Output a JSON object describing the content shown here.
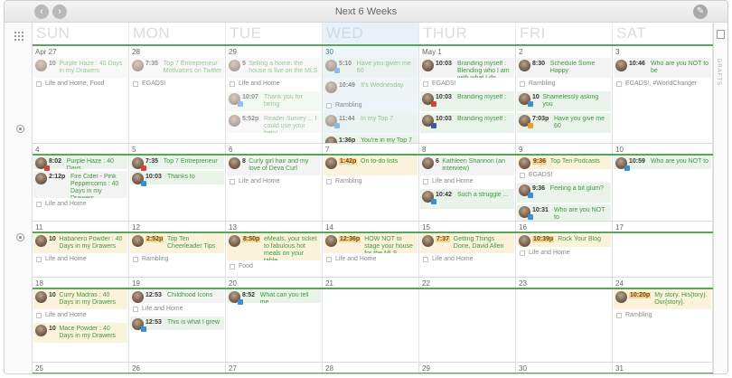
{
  "header": {
    "title": "Next 6 Weeks",
    "prev_icon": "chevron-left-icon",
    "next_icon": "chevron-right-icon",
    "edit_icon": "pencil-icon"
  },
  "sidebar": {
    "drafts_label": "DRAFTS"
  },
  "days": [
    "SUN",
    "MON",
    "TUE",
    "WED",
    "THUR",
    "FRI",
    "SAT"
  ],
  "colors": {
    "accent": "#5aa55a",
    "post_text": "#3d9a3d",
    "time_highlight": "#f5d590",
    "today_bg": "#eef5fa"
  },
  "weeks": [
    {
      "days": [
        {
          "date": "Apr 27",
          "items": [
            {
              "kind": "post",
              "time": "10",
              "text": "Purple Haze : 40 Days in my Drawers",
              "badge": "none",
              "style": "faded"
            },
            {
              "kind": "cat",
              "text": "Life and Home, Food"
            }
          ]
        },
        {
          "date": "28",
          "items": [
            {
              "kind": "post",
              "time": "7:35",
              "text": "Top 7 Entrepreneur Motivators on Twitter",
              "badge": "none",
              "style": "faded"
            },
            {
              "kind": "cat",
              "text": "EGADS!"
            }
          ]
        },
        {
          "date": "29",
          "items": [
            {
              "kind": "post",
              "time": "5",
              "text": "Selling a home: the house is live on the MLS",
              "badge": "none",
              "style": "faded"
            },
            {
              "kind": "cat",
              "text": "Life and Home"
            },
            {
              "kind": "post",
              "time": "10:07",
              "text": "Thank you for being",
              "badge": "tw",
              "style": "faded-hl"
            },
            {
              "kind": "post",
              "time": "5:52p",
              "text": "Reader Survey ... I could use your help!",
              "badge": "none",
              "style": "faded"
            }
          ]
        },
        {
          "date": "30",
          "today": true,
          "items": [
            {
              "kind": "post",
              "time": "5:10",
              "text": "Have you given me 60",
              "badge": "tw",
              "style": "faded-hl"
            },
            {
              "kind": "post",
              "time": "10:49",
              "text": "It's Wednesday",
              "badge": "none",
              "style": "faded"
            },
            {
              "kind": "cat",
              "text": "Rambling"
            },
            {
              "kind": "post",
              "time": "11:44",
              "text": "In my Top 7",
              "badge": "tw",
              "style": "faded-hl"
            },
            {
              "kind": "post",
              "time": "1:36p",
              "text": "You're in my Top 7",
              "badge": "tw",
              "style": "hl"
            }
          ]
        },
        {
          "date": "May 1",
          "items": [
            {
              "kind": "post",
              "time": "10:03",
              "text": "Branding myself : Blending who I am with what I do",
              "badge": "none",
              "style": "plain"
            },
            {
              "kind": "cat",
              "text": "EGADS!"
            },
            {
              "kind": "post",
              "time": "10:03",
              "text": "Branding myself :",
              "badge": "ig",
              "style": "hl"
            },
            {
              "kind": "post",
              "time": "10:03",
              "text": "Branding myself :",
              "badge": "fb",
              "style": "hl"
            }
          ]
        },
        {
          "date": "2",
          "items": [
            {
              "kind": "post",
              "time": "8:30",
              "text": "Schedule Some Happy",
              "badge": "none",
              "style": "plain"
            },
            {
              "kind": "cat",
              "text": "Rambling"
            },
            {
              "kind": "post",
              "time": "10",
              "text": "Shamelessly asking you",
              "badge": "tw",
              "style": "hl"
            },
            {
              "kind": "post",
              "time": "7:03p",
              "text": "Have you give me 60",
              "badge": "rss",
              "style": "hl"
            }
          ]
        },
        {
          "date": "3",
          "items": [
            {
              "kind": "post",
              "time": "10:46",
              "text": "Who are you NOT to be",
              "badge": "none",
              "style": "plain"
            },
            {
              "kind": "cat",
              "text": "EGADS!, #WorldChanger"
            }
          ]
        }
      ]
    },
    {
      "days": [
        {
          "date": "4",
          "items": [
            {
              "kind": "post",
              "time": "8:02",
              "text": "Purple Haze : 40 Days",
              "badge": "ig",
              "style": "hl",
              "mini": true
            },
            {
              "kind": "post",
              "time": "2:12p",
              "text": "Fire Cider - Pink Peppercorns : 40 Days in my Drawers",
              "badge": "none",
              "style": "plain",
              "tall": true
            },
            {
              "kind": "cat",
              "text": "Life and Home"
            }
          ]
        },
        {
          "date": "5",
          "items": [
            {
              "kind": "post",
              "time": "7:35",
              "text": "Top 7 Entrepreneur",
              "badge": "ig",
              "style": "hl",
              "mini": true
            },
            {
              "kind": "post",
              "time": "10:03",
              "text": "Thanks to",
              "badge": "tw",
              "style": "hl",
              "mini": true
            }
          ]
        },
        {
          "date": "6",
          "items": [
            {
              "kind": "post",
              "time": "8",
              "text": "Curly girl hair and my love of Deva Curl",
              "badge": "none",
              "style": "plain"
            },
            {
              "kind": "cat",
              "text": "Life and Home"
            }
          ]
        },
        {
          "date": "7",
          "items": [
            {
              "kind": "post",
              "time": "1:42p",
              "text": "On to-do lists",
              "badge": "none",
              "style": "gold",
              "orange": true
            },
            {
              "kind": "cat",
              "text": "Rambling"
            }
          ]
        },
        {
          "date": "8",
          "items": [
            {
              "kind": "post",
              "time": "6",
              "text": "Kathleen Shannon (an interview)",
              "badge": "none",
              "style": "plain"
            },
            {
              "kind": "cat",
              "text": "Life and Home"
            },
            {
              "kind": "post",
              "time": "10:42",
              "text": "Such a struggle ...",
              "badge": "tw",
              "style": "hl"
            }
          ]
        },
        {
          "date": "9",
          "items": [
            {
              "kind": "post",
              "time": "9:36",
              "text": "Top Ten Podcasts",
              "badge": "none",
              "style": "gold",
              "orange": true,
              "mini": true
            },
            {
              "kind": "cat",
              "text": "EGADS!"
            },
            {
              "kind": "post",
              "time": "9:36",
              "text": "Feeling a bit glum?",
              "badge": "tw",
              "style": "hl"
            },
            {
              "kind": "post",
              "time": "10:31",
              "text": "Who are you NOT to",
              "badge": "tw",
              "style": "hl"
            }
          ]
        },
        {
          "date": "10",
          "items": [
            {
              "kind": "post",
              "time": "10:59",
              "text": "Who are you NOT to",
              "badge": "tw",
              "style": "hl",
              "mini": true
            }
          ]
        }
      ]
    },
    {
      "days": [
        {
          "date": "11",
          "items": [
            {
              "kind": "post",
              "time": "10",
              "text": "Habanero Powder : 40 Days in my Drawers",
              "badge": "none",
              "style": "gold"
            },
            {
              "kind": "cat",
              "text": "Life and Home"
            }
          ]
        },
        {
          "date": "12",
          "items": [
            {
              "kind": "post",
              "time": "2:52p",
              "text": "Top Ten Cheerleader Tips",
              "badge": "none",
              "style": "gold",
              "orange": true
            },
            {
              "kind": "cat",
              "text": "Rambling"
            }
          ]
        },
        {
          "date": "13",
          "items": [
            {
              "kind": "post",
              "time": "8:50p",
              "text": "eMeals, your ticket to fabulous hot meals on your table",
              "badge": "none",
              "style": "gold",
              "orange": true,
              "tall": true
            },
            {
              "kind": "cat",
              "text": "Food"
            }
          ]
        },
        {
          "date": "14",
          "items": [
            {
              "kind": "post",
              "time": "12:36p",
              "text": "HOW NOT to stage your house for the MLS",
              "badge": "none",
              "style": "gold",
              "orange": true
            },
            {
              "kind": "cat",
              "text": "Life and Home"
            }
          ]
        },
        {
          "date": "15",
          "items": [
            {
              "kind": "post",
              "time": "7:37",
              "text": "Getting Things Done, David Allen",
              "badge": "none",
              "style": "gold",
              "orange": true
            },
            {
              "kind": "cat",
              "text": "Life and Home"
            }
          ]
        },
        {
          "date": "16",
          "items": [
            {
              "kind": "post",
              "time": "10:39p",
              "text": "Rock Your Blog",
              "badge": "none",
              "style": "gold",
              "orange": true,
              "mini": true
            },
            {
              "kind": "cat",
              "text": "Life and Home"
            }
          ]
        },
        {
          "date": "17",
          "items": []
        }
      ]
    },
    {
      "days": [
        {
          "date": "18",
          "items": [
            {
              "kind": "post",
              "time": "10",
              "text": "Curry Madras : 40 Days in my Drawers",
              "badge": "none",
              "style": "gold"
            },
            {
              "kind": "cat",
              "text": "Life and Home"
            },
            {
              "kind": "post",
              "time": "10",
              "text": "Mace Powder : 40 Days in my Drawers",
              "badge": "none",
              "style": "gold"
            }
          ]
        },
        {
          "date": "19",
          "items": [
            {
              "kind": "post",
              "time": "12:53",
              "text": "Childhood Icons",
              "badge": "none",
              "style": "plain",
              "mini": true
            },
            {
              "kind": "cat",
              "text": "Life and Home"
            },
            {
              "kind": "post",
              "time": "12:53",
              "text": "This is what I grew",
              "badge": "tw",
              "style": "hl",
              "mini": true
            }
          ]
        },
        {
          "date": "20",
          "items": [
            {
              "kind": "post",
              "time": "8:52",
              "text": "What can you tell me",
              "badge": "tw",
              "style": "hl",
              "mini": true
            }
          ]
        },
        {
          "date": "21",
          "items": []
        },
        {
          "date": "22",
          "items": []
        },
        {
          "date": "23",
          "items": []
        },
        {
          "date": "24",
          "items": [
            {
              "kind": "post",
              "time": "10:20p",
              "text": "My story. His{tory}. Our{story}.",
              "badge": "none",
              "style": "gold",
              "orange": true
            },
            {
              "kind": "cat",
              "text": "Rambling"
            }
          ]
        }
      ]
    },
    {
      "days": [
        {
          "date": "25",
          "items": []
        },
        {
          "date": "26",
          "items": []
        },
        {
          "date": "27",
          "items": []
        },
        {
          "date": "28",
          "items": []
        },
        {
          "date": "29",
          "items": []
        },
        {
          "date": "30",
          "items": []
        },
        {
          "date": "31",
          "items": []
        }
      ]
    }
  ]
}
